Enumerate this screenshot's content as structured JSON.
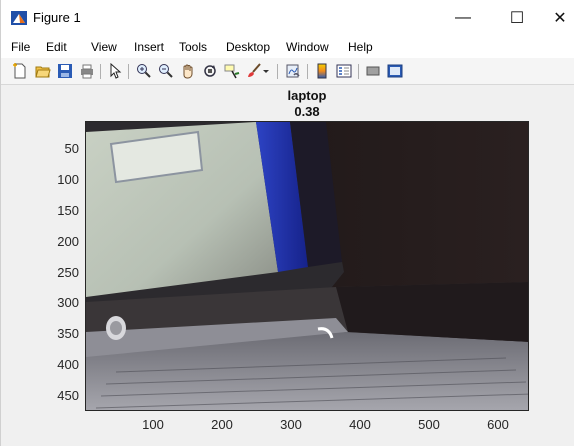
{
  "window": {
    "title": "Figure 1",
    "minimize": "—",
    "maximize": "☐",
    "close": "✕"
  },
  "menu": [
    "File",
    "Edit",
    "View",
    "Insert",
    "Tools",
    "Desktop",
    "Window",
    "Help"
  ],
  "toolbar": {
    "icons": [
      "new-figure-icon",
      "open-file-icon",
      "save-icon",
      "print-icon",
      "pointer-icon",
      "zoom-in-icon",
      "zoom-out-icon",
      "pan-icon",
      "rotate-3d-icon",
      "data-cursor-icon",
      "brush-icon",
      "brush-dropdown-icon",
      "link-plot-icon",
      "colorbar-icon",
      "legend-icon",
      "hide-plot-tools-icon",
      "show-plot-tools-icon"
    ]
  },
  "axes": {
    "title_line1": "laptop",
    "title_line2": "0.38",
    "yticks": [
      "50",
      "100",
      "150",
      "200",
      "250",
      "300",
      "350",
      "400",
      "450"
    ],
    "xticks": [
      "100",
      "200",
      "300",
      "400",
      "500",
      "600"
    ]
  }
}
